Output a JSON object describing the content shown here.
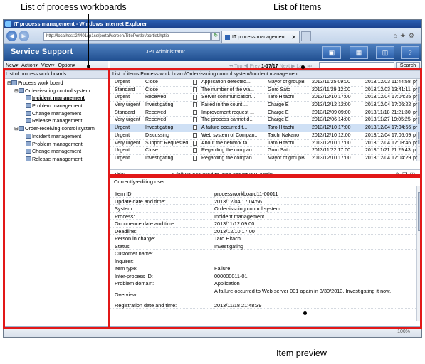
{
  "annotations": {
    "workboards": "List of process workboards",
    "items": "List of Items",
    "preview": "Item preview"
  },
  "browser": {
    "title": "IT process management - Windows Internet Explorer",
    "url": "http://localhost:24401/jp1ss/portal/screen/TitlePortlet/portlet/hptip",
    "tab": "IT process management",
    "zoom": "100%"
  },
  "header": {
    "brand": "Service Support",
    "user": "JP1 Administrator"
  },
  "toolbar": {
    "new": "New▾",
    "action": "Action▾",
    "view": "View▾",
    "option": "Option▾"
  },
  "workboards": {
    "title": "List of process work boards",
    "tree": [
      {
        "label": "Process work board",
        "level": 0,
        "exp": "⊟"
      },
      {
        "label": "Order-issuing control system",
        "level": 1,
        "exp": "⊟"
      },
      {
        "label": "Incident management",
        "level": 2,
        "exp": "",
        "selected": true
      },
      {
        "label": "Problem management",
        "level": 2,
        "exp": ""
      },
      {
        "label": "Change management",
        "level": 2,
        "exp": ""
      },
      {
        "label": "Release management",
        "level": 2,
        "exp": ""
      },
      {
        "label": "Order-receiving control system",
        "level": 1,
        "exp": "⊟"
      },
      {
        "label": "Incident management",
        "level": 2,
        "exp": ""
      },
      {
        "label": "Problem management",
        "level": 2,
        "exp": ""
      },
      {
        "label": "Change management",
        "level": 2,
        "exp": ""
      },
      {
        "label": "Release management",
        "level": 2,
        "exp": ""
      }
    ]
  },
  "pager": {
    "top": "Top",
    "prev": "Prev",
    "range": "1-17/17",
    "next": "Next",
    "last": "Last",
    "search": "Search"
  },
  "items": {
    "title": "List of items:Process work board/Order-issuing control system/Incident management",
    "rows": [
      [
        "Urgent",
        "Close",
        "Application detected...",
        "Mayor of groupB",
        "2013/11/25 09:00",
        "2013/12/03 11:44:58",
        "pr"
      ],
      [
        "Standard",
        "Close",
        "The number of the wa...",
        "Goro Sato",
        "2013/11/29 12:00",
        "2013/12/03 13:41:11",
        "pr"
      ],
      [
        "Urgent",
        "Received",
        "Server communication...",
        "Taro Hitachi",
        "2013/12/10 17:00",
        "2013/12/04 17:04:25",
        "pr"
      ],
      [
        "Very urgent",
        "Investigating",
        "Failed in the count ...",
        "Charge E",
        "2013/12/12 12:00",
        "2013/12/04 17:05:22",
        "pr"
      ],
      [
        "Standard",
        "Received",
        "Improvement request ...",
        "Charge E",
        "2013/12/09 09:00",
        "2013/11/18 21:21:30",
        "pr"
      ],
      [
        "Very urgent",
        "Received",
        "The process cannot d...",
        "Charge E",
        "2013/12/06 14:00",
        "2013/11/27 19:05:25",
        "pr"
      ],
      [
        "Urgent",
        "Investigating",
        "A failure occurred t...",
        "Taro Hitachi",
        "2013/12/10 17:00",
        "2013/12/04 17:04:56",
        "pr"
      ],
      [
        "Urgent",
        "Discussing",
        "Web system of Compan...",
        "Taichi Nakano",
        "2013/12/10 12:00",
        "2013/12/04 17:05:09",
        "pr"
      ],
      [
        "Very urgent",
        "Support Requested",
        "About the network fa...",
        "Taro Hitachi",
        "2013/12/10 17:00",
        "2013/12/04 17:03:46",
        "pr"
      ],
      [
        "Urgent",
        "Close",
        "Regarding the compan...",
        "Goro Sato",
        "2013/11/22 17:00",
        "2013/11/21 21:29:43",
        "pr"
      ],
      [
        "Urgent",
        "Investigating",
        "Regarding the compan...",
        "Mayor of groupB",
        "2013/12/10 17:00",
        "2013/12/04 17:04:29",
        "pr"
      ]
    ]
  },
  "preview": {
    "title_label": "Title:",
    "title_value": "A failure occurred to Web server 001 again",
    "editor_label": "Currently-editing user:",
    "fields": [
      {
        "k": "Item ID:",
        "v": "processworkboard11-00011"
      },
      {
        "k": "Update date and time:",
        "v": "2013/12/04 17:04:56"
      },
      {
        "k": "System:",
        "v": "Order-issuing control system"
      },
      {
        "k": "Process:",
        "v": "Incident management"
      },
      {
        "k": "Occurrence date and time:",
        "v": "2013/11/12 09:00"
      },
      {
        "k": "Deadline:",
        "v": "2013/12/10 17:00"
      },
      {
        "k": "Person in charge:",
        "v": "Taro Hitachi"
      },
      {
        "k": "Status:",
        "v": "Investigating"
      },
      {
        "k": "Customer name:",
        "v": ""
      },
      {
        "k": "Inquirer:",
        "v": ""
      },
      {
        "k": "Item type:",
        "v": "Failure"
      },
      {
        "k": "Inter-process ID:",
        "v": "000000011-01"
      },
      {
        "k": "Problem domain:",
        "v": "Application"
      },
      {
        "k": "Overview:",
        "v": "A failure occurred to Web server 001 again in 3/30/2013. Investigating it now.",
        "tall": true
      },
      {
        "k": "Registration date and time:",
        "v": "2013/11/18 21:48:39"
      }
    ]
  }
}
